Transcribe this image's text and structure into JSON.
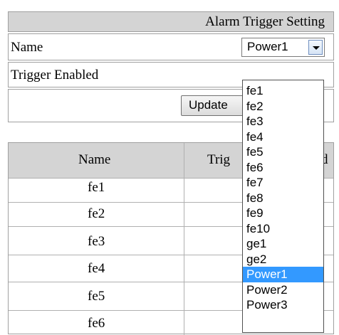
{
  "settings": {
    "title": "Alarm Trigger Setting",
    "name_label": "Name",
    "trigger_label": "Trigger Enabled",
    "name_selected": "Power1",
    "update_label": "Update"
  },
  "list": {
    "col_name": "Name",
    "col_trigger": "Trig",
    "col_trigger_tail": "d",
    "rows": [
      "fe1",
      "fe2",
      "fe3",
      "fe4",
      "fe5",
      "fe6"
    ]
  },
  "dropdown": {
    "options": [
      "fe1",
      "fe2",
      "fe3",
      "fe4",
      "fe5",
      "fe6",
      "fe7",
      "fe8",
      "fe9",
      "fe10",
      "ge1",
      "ge2",
      "Power1",
      "Power2",
      "Power3"
    ],
    "highlighted": "Power1"
  },
  "colors": {
    "header_bg": "#d4d4d4",
    "selection": "#3399ff"
  }
}
